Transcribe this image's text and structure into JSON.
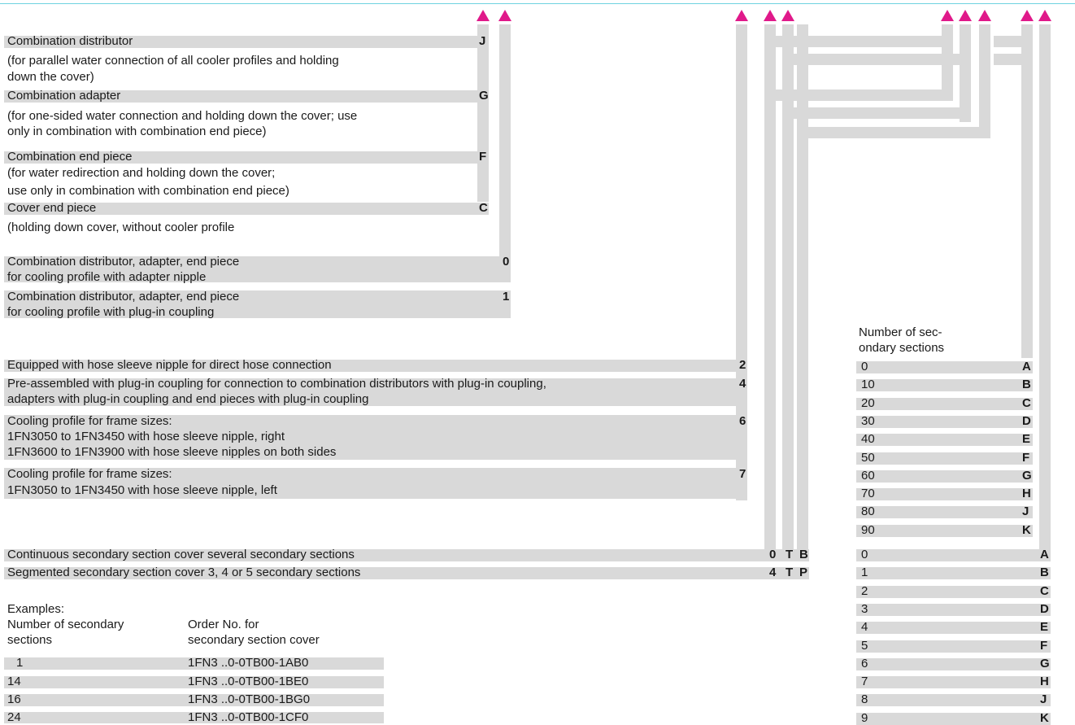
{
  "accessories": {
    "combination_distributor": {
      "label": "Combination distributor",
      "note": [
        "(for parallel water connection of all cooler profiles and holding",
        "down the cover)"
      ],
      "code": "J"
    },
    "combination_adapter": {
      "label": "Combination adapter",
      "note": [
        "(for one-sided water connection and holding down the cover; use",
        "only in combination with combination end piece)"
      ],
      "code": "G"
    },
    "combination_end_piece": {
      "label": "Combination end piece",
      "note": [
        "(for water redirection and holding down the cover;",
        "use only in combination with combination end piece)"
      ],
      "code": "F"
    },
    "cover_end_piece": {
      "label": "Cover end piece",
      "note": [
        "(holding down cover, without cooler profile"
      ],
      "code": "C"
    }
  },
  "profile_type": [
    {
      "lines": [
        "Combination distributor, adapter, end piece",
        "for cooling profile with adapter nipple"
      ],
      "code": "0"
    },
    {
      "lines": [
        "Combination distributor, adapter, end piece",
        "for cooling profile with plug-in coupling"
      ],
      "code": "1"
    }
  ],
  "connection": [
    {
      "lines": [
        "Equipped with hose sleeve nipple for direct hose connection"
      ],
      "code": "2"
    },
    {
      "lines": [
        "Pre-assembled with plug-in coupling for connection to combination distributors with plug-in coupling,",
        "adapters with plug-in coupling and end pieces with plug-in coupling"
      ],
      "code": "4"
    },
    {
      "lines": [
        "Cooling profile for frame sizes:",
        "1FN3050 to 1FN3450 with hose sleeve nipple, right",
        "1FN3600 to 1FN3900 with hose sleeve nipples on both sides"
      ],
      "code": "6"
    },
    {
      "lines": [
        "Cooling profile for frame sizes:",
        "1FN3050 to 1FN3450 with hose sleeve nipple, left"
      ],
      "code": "7"
    }
  ],
  "cover_type": [
    {
      "label": "Continuous secondary section cover several secondary sections",
      "codes": [
        "0",
        "T",
        "B"
      ]
    },
    {
      "label": "Segmented secondary section cover 3, 4 or 5 secondary sections",
      "codes": [
        "4",
        "T",
        "P"
      ]
    }
  ],
  "examples": {
    "title": "Examples:",
    "col1": [
      "Number of secondary",
      "sections"
    ],
    "col2": [
      "Order No. for",
      "secondary section cover"
    ],
    "rows": [
      {
        "n": "1",
        "order": "1FN3 ..0-0TB00-1AB0"
      },
      {
        "n": "14",
        "order": "1FN3 ..0-0TB00-1BE0"
      },
      {
        "n": "16",
        "order": "1FN3 ..0-0TB00-1BG0"
      },
      {
        "n": "24",
        "order": "1FN3 ..0-0TB00-1CF0"
      }
    ]
  },
  "sections": {
    "header": [
      "Number of sec-",
      "ondary sections"
    ],
    "tens": [
      {
        "n": "0",
        "c": "A"
      },
      {
        "n": "10",
        "c": "B"
      },
      {
        "n": "20",
        "c": "C"
      },
      {
        "n": "30",
        "c": "D"
      },
      {
        "n": "40",
        "c": "E"
      },
      {
        "n": "50",
        "c": "F"
      },
      {
        "n": "60",
        "c": "G"
      },
      {
        "n": "70",
        "c": "H"
      },
      {
        "n": "80",
        "c": "J"
      },
      {
        "n": "90",
        "c": "K"
      }
    ],
    "units": [
      {
        "n": "0",
        "c": "A"
      },
      {
        "n": "1",
        "c": "B"
      },
      {
        "n": "2",
        "c": "C"
      },
      {
        "n": "3",
        "c": "D"
      },
      {
        "n": "4",
        "c": "E"
      },
      {
        "n": "5",
        "c": "F"
      },
      {
        "n": "6",
        "c": "G"
      },
      {
        "n": "7",
        "c": "H"
      },
      {
        "n": "8",
        "c": "J"
      },
      {
        "n": "9",
        "c": "K"
      }
    ]
  },
  "colors": {
    "bar": "#d9d9d9",
    "arrow": "#e0198a",
    "top_rule": "#6fd3e0"
  }
}
